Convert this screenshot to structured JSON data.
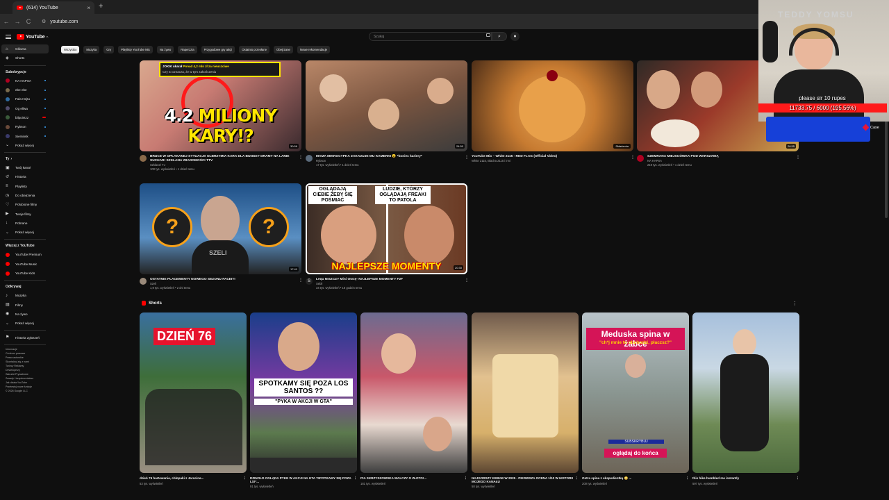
{
  "browser": {
    "tab_title": "(614) YouTube",
    "tab_close": "×",
    "new_tab": "+",
    "url": "youtube.com",
    "back": "←",
    "forward": "→",
    "reload": "C"
  },
  "masthead": {
    "logo_text": "YouTube",
    "country_code": "PL",
    "search_placeholder": "Szukaj",
    "search_icon": "⌕",
    "mic_icon": "🎙"
  },
  "sidebar": {
    "main": [
      {
        "label": "Główna",
        "icon": "home-icon",
        "glyph": "⌂",
        "active": true
      },
      {
        "label": "Shorts",
        "icon": "shorts-icon",
        "glyph": "◈",
        "active": false
      }
    ],
    "subs_header": "Subskrypcje",
    "subs": [
      {
        "label": "NA HAPSA",
        "color": "#b00020",
        "indicator": "dot"
      },
      {
        "label": "ebe ebe",
        "color": "#7a6b4d",
        "indicator": "dot"
      },
      {
        "label": "Fala Hejtu",
        "color": "#2f6ba0",
        "indicator": "dot"
      },
      {
        "label": "Og ellwa",
        "color": "#514b6a",
        "indicator": "dot"
      },
      {
        "label": "bilpointzz",
        "color": "#3a5a3a",
        "indicator": "live"
      },
      {
        "label": "Rybson",
        "color": "#6a4a3a",
        "indicator": "dot"
      },
      {
        "label": "Sieminsk",
        "color": "#3a3a6a",
        "indicator": "dot"
      }
    ],
    "subs_more": "Pokaż więcej",
    "you_header": "Ty",
    "you_items": [
      {
        "label": "Twój kanał",
        "glyph": "▣"
      },
      {
        "label": "Historia",
        "glyph": "↺"
      },
      {
        "label": "Playlisty",
        "glyph": "≡"
      },
      {
        "label": "Do obejrzenia",
        "glyph": "◷"
      },
      {
        "label": "Polubione filmy",
        "glyph": "♡"
      },
      {
        "label": "Twoje filmy",
        "glyph": "▶"
      },
      {
        "label": "Pobrane",
        "glyph": "↓"
      },
      {
        "label": "Pokaż więcej",
        "glyph": "⌄"
      }
    ],
    "more_header": "Więcej z YouTube",
    "more_items": [
      {
        "label": "YouTube Premium"
      },
      {
        "label": "YouTube Music"
      },
      {
        "label": "YouTube Kids"
      }
    ],
    "explore_header": "Odkrywaj",
    "explore_items": [
      {
        "label": "Muzyka",
        "glyph": "♪"
      },
      {
        "label": "Filmy",
        "glyph": "▤"
      },
      {
        "label": "Na żywo",
        "glyph": "◉"
      },
      {
        "label": "Pokaż więcej",
        "glyph": "⌄"
      }
    ],
    "history_item": "Historia zgłoszeń",
    "footer_lines": [
      "Informacje",
      "Centrum prasowe",
      "Prawa autorskie",
      "Skontaktuj się z nami",
      "Twórcy   Reklamy",
      "Deweloperzy",
      "Warunki   Prywatność",
      "Zasady i bezpieczeństwo",
      "Jak działa YouTube",
      "Przetestuj nowe funkcje",
      "© 2026 Google LLC"
    ]
  },
  "chips": [
    "Wszystko",
    "Muzyka",
    "Gry",
    "Playlisty YouTube Mix",
    "Na żywo",
    "Raperzzia",
    "Przygodowe gry akcji",
    "Ostatnio przesłane",
    "Obejrzane",
    "Nowe rekomendacje"
  ],
  "videos": [
    {
      "title": "BRUCE W OPŁAKANEJ SYTUACJI! OLBRZYMIA KARA DLA BUNGE? DRAMY NA LANIE SUCHAR! SZKLANA WIADOMOŚCI TTV",
      "channel": "Szklane/ TJ",
      "stats": "100 tys. wyświetleń • 1 dzień temu",
      "duration": "30:56",
      "overlay_main": "4.2",
      "overlay_rest": "MILIONY KARY!?",
      "notif_line1_a": "JOKIK ukarał ",
      "notif_line1_b": "Ponad 4,2 mln zł za nieuczciwe",
      "notif_line2": "Czy to oznacza, że w tym zakończeniu"
    },
    {
      "title": "MAMA MIKROCYPKA ZAKAZUJE MU KAMERKI 😮 *koniec kariery*",
      "channel": "Rybson",
      "stats": "17 tys. wyświetleń • 1 dzień temu",
      "duration": "24:50"
    },
    {
      "title": "YouTube Mix – White 2115 - RED FLAG (Official Video)",
      "channel": "White 2115, Blacha 2115 i inni",
      "stats": "",
      "duration": "Składanka"
    },
    {
      "title": "SZEMRANA MIEJSCÓWKA POD WARSZAWĄ",
      "channel": "NA HAPSA",
      "stats": "219 tys. wyświetleń • 1 dzień temu",
      "duration": "26:55"
    },
    {
      "title": "OSTATNIE PLACEMENTY NOWEGO SEZONU FACEIT!",
      "channel": "Szeli",
      "stats": "1,9 tys. wyświetleń • 2 dni temu",
      "duration": "17:41",
      "overlay_word": "SZELI",
      "coin_glyph": "?"
    },
    {
      "title": "Lequ NISZCZY Mini Owcę- NAJLEPSZE MOMENTY F2F",
      "channel": "Sebil",
      "stats": "34 tys. wyświetleń • 18 godzin temu",
      "duration": "20:30",
      "cap_left": "OGLĄDAJĄ CIEBIE ŻEBY SIĘ POŚMIAĆ",
      "cap_right": "LUDZIE, KTÓRZY OGLĄDAJĄ FREAKI TO PATOLA",
      "overlay_bottom": "NAJLEPSZE MOMENTY"
    }
  ],
  "shorts": {
    "header": "Shorts",
    "items": [
      {
        "title": "dzień 76 hartowania, chłopaki z Jarocina...",
        "views": "53 tys. wyświetleń",
        "caption": "DZIEŃ 76"
      },
      {
        "title": "DZINOLD OGLĄDA PYKE W AKCJI NA GTA *SPOTKAMY SIĘ POZA LS!*...",
        "views": "91 tys. wyświetleń",
        "caption": "SPOTKAMY SIĘ POZA LOS SANTOS ??",
        "caption2": "\"PYKA W AKCJI W GTA\""
      },
      {
        "title": "PIA SKRZYSZOWSKA WALCZY O ZŁOTO!...",
        "views": "181 tys. wyświetleń",
        "caption": ""
      },
      {
        "title": "NAJGORSZY KEBAB W 2025 - PIERWSZA OCENA 1/10 W HISTORII MOJEGO KANAŁU",
        "views": "58 tys. wyświetleń",
        "caption": ""
      },
      {
        "title": "Ostra spina z ekspedientką 😳 ...",
        "views": "200 tys. wyświetleń",
        "caption": "Meduska spina w żabce",
        "caption_sub": "\"ch*j mnie to obchodzi, płaczsz?\"",
        "caption_bot": "oglądaj do końca",
        "caption_sub_bot": "SUBSKRYBUJ"
      },
      {
        "title": "this hike humbled me instantly",
        "views": "597 tys. wyświetleń",
        "caption": ""
      }
    ]
  },
  "overlay": {
    "sign": "TEDDY YOMSU",
    "donate_text": "please sir 10 rupes",
    "donate_progress": "11733.75 / 6000 (195.56%)",
    "case_label": "Case"
  }
}
